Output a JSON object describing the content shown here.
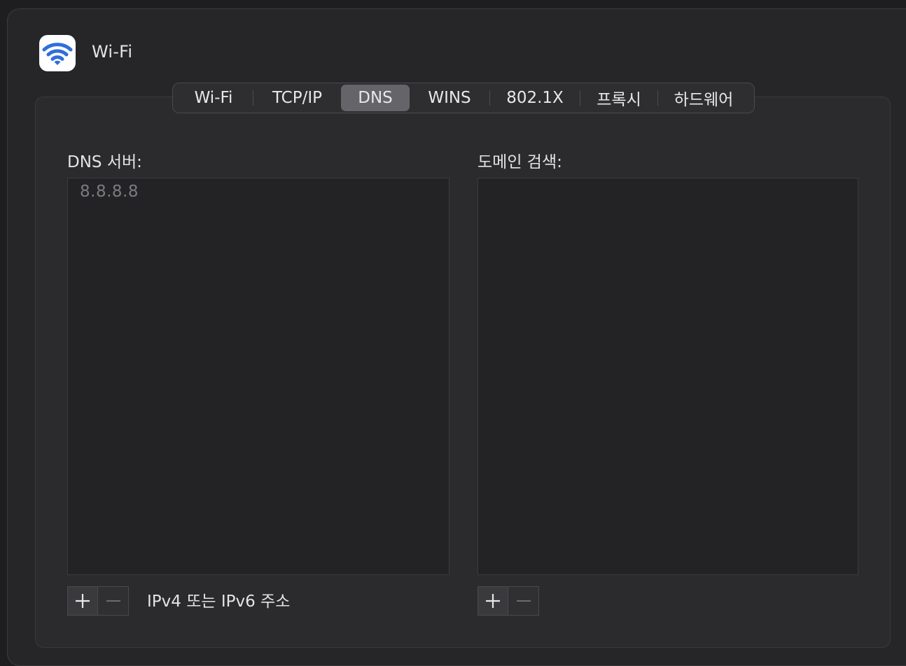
{
  "window": {
    "title": "Wi-Fi",
    "icon": "wifi-icon",
    "accent": "#2f6fdb"
  },
  "tabs": [
    {
      "label": "Wi-Fi",
      "active": false
    },
    {
      "label": "TCP/IP",
      "active": false
    },
    {
      "label": "DNS",
      "active": true
    },
    {
      "label": "WINS",
      "active": false
    },
    {
      "label": "802.1X",
      "active": false
    },
    {
      "label": "프록시",
      "active": false
    },
    {
      "label": "하드웨어",
      "active": false
    }
  ],
  "dns": {
    "label": "DNS 서버:",
    "servers": [
      "8.8.8.8"
    ],
    "hint": "IPv4 또는 IPv6 주소"
  },
  "search_domains": {
    "label": "도메인 검색:",
    "domains": []
  }
}
